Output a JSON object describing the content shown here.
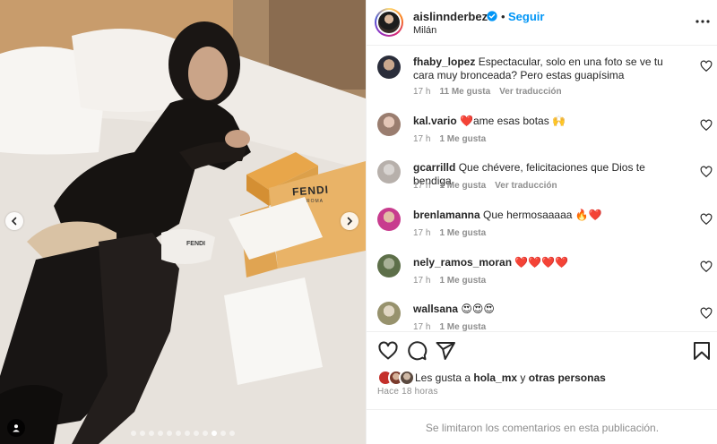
{
  "post": {
    "image_nav": {
      "prev_icon": "chevron-left-icon",
      "next_icon": "chevron-right-icon",
      "slide_count": 12,
      "active_slide": 9
    },
    "photo_text": {
      "brand_box": "FENDI",
      "brand_sub": "ROMA"
    }
  },
  "header": {
    "username": "aislinnderbez",
    "separator": "•",
    "follow_label": "Seguir",
    "location": "Milán",
    "more_icon": "more-horizontal-icon"
  },
  "comments": [
    {
      "username": "fhaby_lopez",
      "text": "Espectacular, solo en una foto se ve tu cara muy bronceada? Pero estas guapísima",
      "time": "17 h",
      "likes": "11 Me gusta",
      "translate": "Ver traducción"
    },
    {
      "username": "kal.vario",
      "text": "❤️ame esas botas 🙌",
      "time": "17 h",
      "likes": "1 Me gusta",
      "translate": ""
    },
    {
      "username": "gcarrilld",
      "text": "Que chévere, felicitaciones que Dios te bendiga",
      "time": "17 h",
      "likes": "1 Me gusta",
      "translate": "Ver traducción"
    },
    {
      "username": "brenlamanna",
      "text": "Que hermosaaaaa 🔥❤️",
      "time": "17 h",
      "likes": "1 Me gusta",
      "translate": ""
    },
    {
      "username": "nely_ramos_moran",
      "text": "❤️❤️❤️❤️",
      "time": "17 h",
      "likes": "1 Me gusta",
      "translate": ""
    },
    {
      "username": "wallsana",
      "text": "😍😍😍",
      "time": "17 h",
      "likes": "1 Me gusta",
      "translate": ""
    }
  ],
  "actions": {
    "like_icon": "heart-icon",
    "comment_icon": "comment-icon",
    "share_icon": "share-icon",
    "save_icon": "bookmark-icon"
  },
  "likes": {
    "prefix": "Les gusta a",
    "user": "hola_mx",
    "joiner": "y",
    "others": "otras personas"
  },
  "time_ago": "Hace 18 horas",
  "comments_limited": "Se limitaron los comentarios en esta publicación."
}
